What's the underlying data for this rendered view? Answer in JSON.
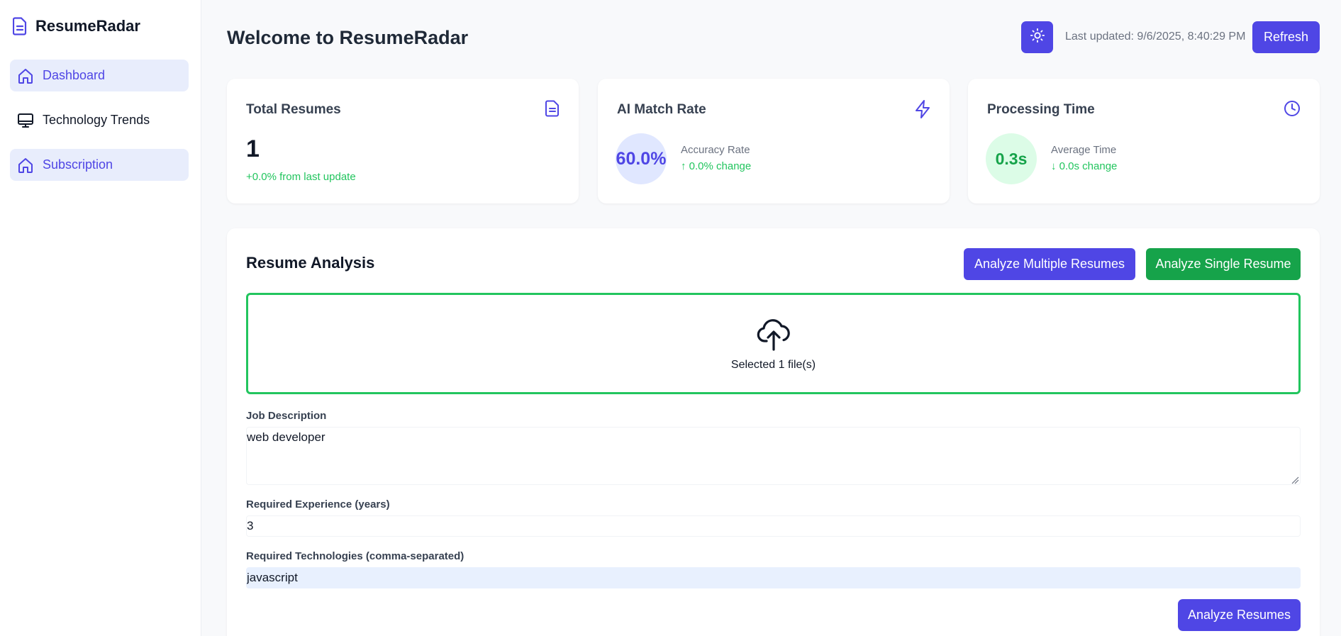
{
  "app": {
    "name": "ResumeRadar",
    "logo_icon": "document-icon"
  },
  "sidebar": {
    "items": [
      {
        "label": "Dashboard",
        "icon": "home-icon",
        "active": true
      },
      {
        "label": "Technology Trends",
        "icon": "monitor-icon",
        "active": false
      },
      {
        "label": "Subscription",
        "icon": "home-icon",
        "active": true
      }
    ]
  },
  "header": {
    "title": "Welcome to ResumeRadar",
    "theme_icon": "sun-icon",
    "last_updated": "Last updated: 9/6/2025, 8:40:29 PM",
    "refresh_label": "Refresh"
  },
  "stats": {
    "total_resumes": {
      "title": "Total Resumes",
      "value": "1",
      "sub": "+0.0% from last update",
      "icon": "document-icon"
    },
    "ai_match": {
      "title": "AI Match Rate",
      "value": "60.0%",
      "label": "Accuracy Rate",
      "change": "↑ 0.0% change",
      "icon": "lightning-icon"
    },
    "processing": {
      "title": "Processing Time",
      "value": "0.3s",
      "label": "Average Time",
      "change": "↓ 0.0s change",
      "icon": "clock-icon"
    }
  },
  "analysis": {
    "title": "Resume Analysis",
    "multi_label": "Analyze Multiple Resumes",
    "single_label": "Analyze Single Resume",
    "dropzone_text": "Selected 1 file(s)",
    "dropzone_icon": "cloud-upload-icon",
    "job_description_label": "Job Description",
    "job_description_value": "web developer",
    "experience_label": "Required Experience (years)",
    "experience_value": "3",
    "technologies_label": "Required Technologies (comma-separated)",
    "technologies_value": "javascript",
    "analyze_label": "Analyze Resumes"
  },
  "colors": {
    "primary": "#4f46e5",
    "success": "#16a34a",
    "success_text": "#22c55e",
    "active_nav_bg": "#e8edfc"
  }
}
